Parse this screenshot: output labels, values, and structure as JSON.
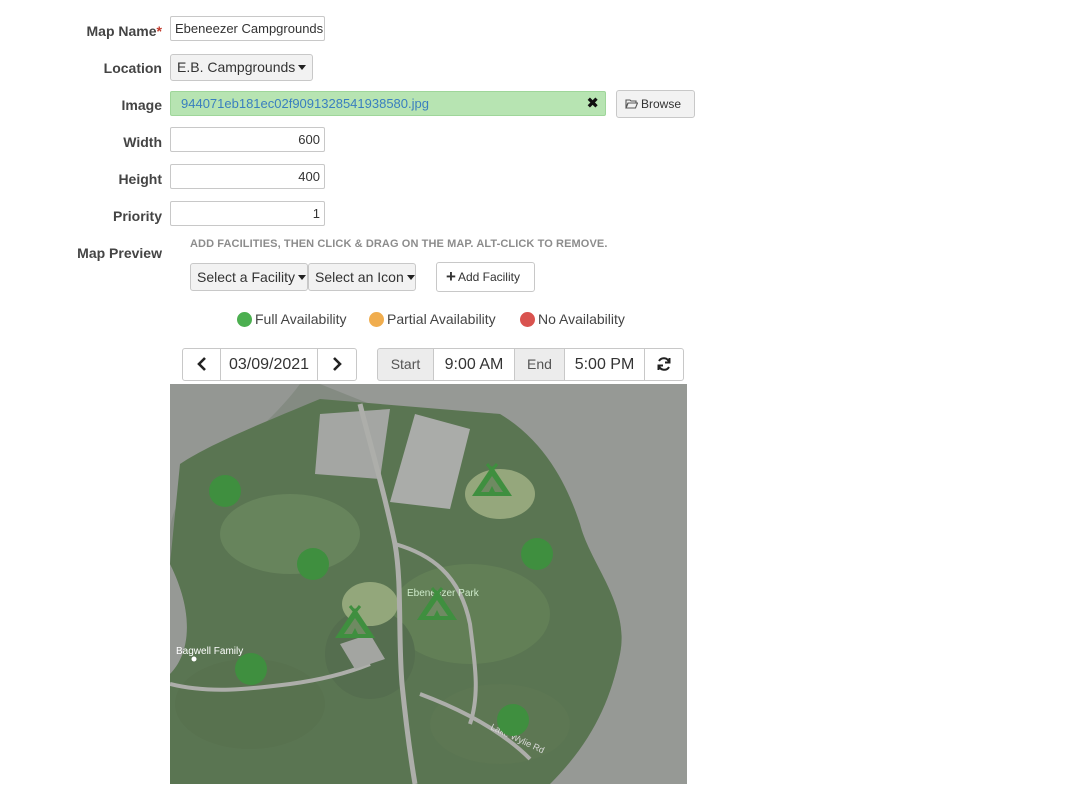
{
  "form": {
    "map_name_label": "Map Name",
    "required_mark": "*",
    "map_name_value": "Ebeneezer Campgrounds",
    "location_label": "Location",
    "location_value": "E.B. Campgrounds",
    "image_label": "Image",
    "image_filename": "944071eb181ec02f9091328541938580.jpg",
    "clear_icon": "✖",
    "browse_label": "Browse",
    "width_label": "Width",
    "width_value": "600",
    "height_label": "Height",
    "height_value": "400",
    "priority_label": "Priority",
    "priority_value": "1",
    "map_preview_label": "Map Preview"
  },
  "preview": {
    "hint": "ADD FACILITIES, THEN CLICK & DRAG ON THE MAP. ALT-CLICK TO REMOVE.",
    "facility_select": "Select a Facility",
    "icon_select": "Select an Icon",
    "add_facility": "Add Facility",
    "add_icon_glyph": "+"
  },
  "legend": [
    {
      "label": "Full Availability",
      "color": "#4caf50"
    },
    {
      "label": "Partial Availability",
      "color": "#f0ad4e"
    },
    {
      "label": "No Availability",
      "color": "#d9534f"
    }
  ],
  "toolbar": {
    "prev_glyph": "‹",
    "date": "03/09/2021",
    "next_glyph": "›",
    "start_label": "Start",
    "start_time": "9:00 AM",
    "end_label": "End",
    "end_time": "5:00 PM",
    "refresh_glyph": "↻"
  },
  "map": {
    "place_labels": {
      "park": "Ebeneezer Park",
      "family": "Bagwell Family",
      "road": "Lake Wylie Rd"
    },
    "marker_color": "#3f8f3f",
    "markers": [
      {
        "type": "circle",
        "status": "full"
      },
      {
        "type": "circle",
        "status": "full"
      },
      {
        "type": "circle",
        "status": "full"
      },
      {
        "type": "circle",
        "status": "full"
      },
      {
        "type": "circle",
        "status": "full"
      },
      {
        "type": "tent",
        "status": "full"
      },
      {
        "type": "tent",
        "status": "full"
      },
      {
        "type": "tent",
        "status": "full"
      }
    ]
  }
}
